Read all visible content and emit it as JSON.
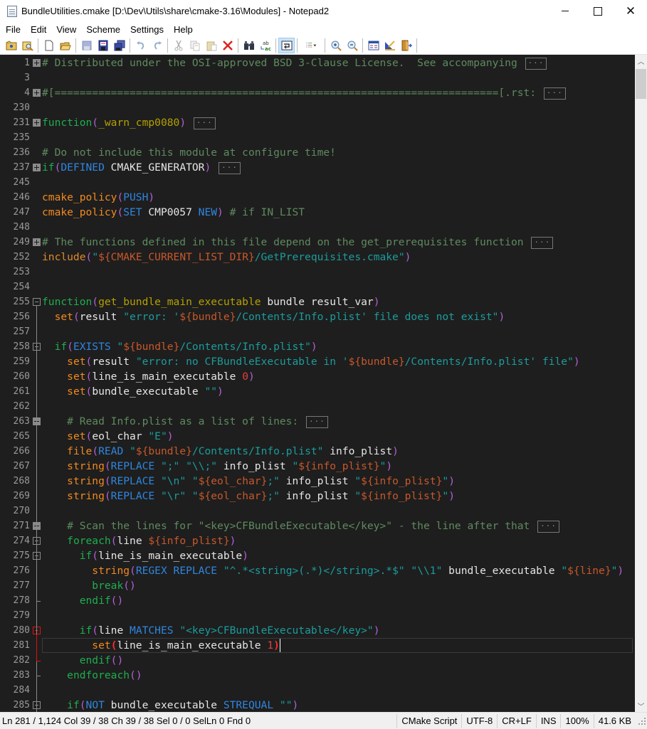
{
  "window": {
    "title": "BundleUtilities.cmake [D:\\Dev\\Utils\\share\\cmake-3.16\\Modules] - Notepad2",
    "minimize_glyph": "",
    "maximize_glyph": "",
    "close_glyph": "✕"
  },
  "menu": [
    "File",
    "Edit",
    "View",
    "Scheme",
    "Settings",
    "Help"
  ],
  "toolbar": {
    "buttons": [
      {
        "name": "browse-icon"
      },
      {
        "name": "find-file-icon"
      },
      {
        "name": "new-file-icon"
      },
      {
        "name": "open-file-icon"
      },
      {
        "name": "save-icon"
      },
      {
        "name": "save-as-icon"
      },
      {
        "name": "save-copy-icon"
      },
      {
        "name": "undo-icon"
      },
      {
        "name": "redo-icon"
      },
      {
        "name": "cut-icon"
      },
      {
        "name": "copy-icon"
      },
      {
        "name": "paste-icon"
      },
      {
        "name": "delete-icon"
      },
      {
        "name": "find-icon"
      },
      {
        "name": "replace-icon"
      },
      {
        "name": "word-wrap-icon",
        "active": true
      },
      {
        "name": "view-options-icon"
      },
      {
        "name": "zoom-in-icon"
      },
      {
        "name": "zoom-out-icon"
      },
      {
        "name": "scheme-icon"
      },
      {
        "name": "customize-scheme-icon"
      },
      {
        "name": "exit-icon"
      }
    ]
  },
  "editor": {
    "language": "CMake",
    "current_line": 281,
    "lines": [
      {
        "n": "1",
        "fold": "plus",
        "ellipsis": true,
        "tokens": [
          [
            "c-comment",
            "# Distributed under the OSI-approved BSD 3-Clause License.  See accompanying"
          ]
        ]
      },
      {
        "n": "3",
        "tokens": []
      },
      {
        "n": "4",
        "fold": "plus",
        "ellipsis": true,
        "tokens": [
          [
            "c-comment",
            "#[=======================================================================[.rst:"
          ]
        ]
      },
      {
        "n": "230",
        "tokens": []
      },
      {
        "n": "231",
        "fold": "plus",
        "ellipsis": true,
        "tokens": [
          [
            "c-kw",
            "function"
          ],
          [
            "c-paren",
            "("
          ],
          [
            "c-fn",
            "_warn_cmp0080"
          ],
          [
            "c-paren",
            ")"
          ]
        ]
      },
      {
        "n": "235",
        "tokens": []
      },
      {
        "n": "236",
        "tokens": [
          [
            "c-comment",
            "# Do not include this module at configure time!"
          ]
        ]
      },
      {
        "n": "237",
        "fold": "plus",
        "ellipsis": true,
        "tokens": [
          [
            "c-kw",
            "if"
          ],
          [
            "c-paren",
            "("
          ],
          [
            "c-arg",
            "DEFINED"
          ],
          [
            "c-plain",
            " CMAKE_GENERATOR"
          ],
          [
            "c-paren",
            ")"
          ]
        ]
      },
      {
        "n": "245",
        "tokens": []
      },
      {
        "n": "246",
        "tokens": [
          [
            "c-cmd",
            "cmake_policy"
          ],
          [
            "c-paren",
            "("
          ],
          [
            "c-arg",
            "PUSH"
          ],
          [
            "c-paren",
            ")"
          ]
        ]
      },
      {
        "n": "247",
        "tokens": [
          [
            "c-cmd",
            "cmake_policy"
          ],
          [
            "c-paren",
            "("
          ],
          [
            "c-arg",
            "SET"
          ],
          [
            "c-plain",
            " CMP0057 "
          ],
          [
            "c-arg",
            "NEW"
          ],
          [
            "c-paren",
            ")"
          ],
          [
            "c-comment",
            " # if IN_LIST"
          ]
        ]
      },
      {
        "n": "248",
        "tokens": []
      },
      {
        "n": "249",
        "fold": "plus",
        "ellipsis": true,
        "tokens": [
          [
            "c-comment",
            "# The functions defined in this file depend on the get_prerequisites function"
          ]
        ]
      },
      {
        "n": "252",
        "tokens": [
          [
            "c-inc",
            "include"
          ],
          [
            "c-paren",
            "("
          ],
          [
            "c-str",
            "\""
          ],
          [
            "c-var",
            "${CMAKE_CURRENT_LIST_DIR}"
          ],
          [
            "c-str",
            "/GetPrerequisites.cmake\""
          ],
          [
            "c-paren",
            ")"
          ]
        ]
      },
      {
        "n": "253",
        "tokens": []
      },
      {
        "n": "254",
        "tokens": []
      },
      {
        "n": "255",
        "fold": "minus",
        "tokens": [
          [
            "c-kw",
            "function"
          ],
          [
            "c-paren",
            "("
          ],
          [
            "c-fn",
            "get_bundle_main_executable"
          ],
          [
            "c-plain",
            " bundle result_var"
          ],
          [
            "c-paren",
            ")"
          ]
        ]
      },
      {
        "n": "256",
        "tokens": [
          [
            "c-plain",
            "  "
          ],
          [
            "c-cmd",
            "set"
          ],
          [
            "c-paren",
            "("
          ],
          [
            "c-plain",
            "result "
          ],
          [
            "c-str",
            "\"error: '"
          ],
          [
            "c-var",
            "${bundle}"
          ],
          [
            "c-str",
            "/Contents/Info.plist' file does not exist\""
          ],
          [
            "c-paren",
            ")"
          ]
        ]
      },
      {
        "n": "257",
        "tokens": []
      },
      {
        "n": "258",
        "fold": "minus",
        "tokens": [
          [
            "c-plain",
            "  "
          ],
          [
            "c-kw",
            "if"
          ],
          [
            "c-paren",
            "("
          ],
          [
            "c-arg",
            "EXISTS"
          ],
          [
            "c-plain",
            " "
          ],
          [
            "c-str",
            "\""
          ],
          [
            "c-var",
            "${bundle}"
          ],
          [
            "c-str",
            "/Contents/Info.plist\""
          ],
          [
            "c-paren",
            ")"
          ]
        ]
      },
      {
        "n": "259",
        "tokens": [
          [
            "c-plain",
            "    "
          ],
          [
            "c-cmd",
            "set"
          ],
          [
            "c-paren",
            "("
          ],
          [
            "c-plain",
            "result "
          ],
          [
            "c-str",
            "\"error: no CFBundleExecutable in '"
          ],
          [
            "c-var",
            "${bundle}"
          ],
          [
            "c-str",
            "/Contents/Info.plist' file\""
          ],
          [
            "c-paren",
            ")"
          ]
        ]
      },
      {
        "n": "260",
        "tokens": [
          [
            "c-plain",
            "    "
          ],
          [
            "c-cmd",
            "set"
          ],
          [
            "c-paren",
            "("
          ],
          [
            "c-plain",
            "line_is_main_executable "
          ],
          [
            "c-num",
            "0"
          ],
          [
            "c-paren",
            ")"
          ]
        ]
      },
      {
        "n": "261",
        "tokens": [
          [
            "c-plain",
            "    "
          ],
          [
            "c-cmd",
            "set"
          ],
          [
            "c-paren",
            "("
          ],
          [
            "c-plain",
            "bundle_executable "
          ],
          [
            "c-str",
            "\"\""
          ],
          [
            "c-paren",
            ")"
          ]
        ]
      },
      {
        "n": "262",
        "tokens": []
      },
      {
        "n": "263",
        "fold": "plus",
        "ellipsis": true,
        "tokens": [
          [
            "c-plain",
            "    "
          ],
          [
            "c-comment",
            "# Read Info.plist as a list of lines:"
          ]
        ]
      },
      {
        "n": "265",
        "tokens": [
          [
            "c-plain",
            "    "
          ],
          [
            "c-cmd",
            "set"
          ],
          [
            "c-paren",
            "("
          ],
          [
            "c-plain",
            "eol_char "
          ],
          [
            "c-str",
            "\"E\""
          ],
          [
            "c-paren",
            ")"
          ]
        ]
      },
      {
        "n": "266",
        "tokens": [
          [
            "c-plain",
            "    "
          ],
          [
            "c-cmd",
            "file"
          ],
          [
            "c-paren",
            "("
          ],
          [
            "c-arg",
            "READ"
          ],
          [
            "c-plain",
            " "
          ],
          [
            "c-str",
            "\""
          ],
          [
            "c-var",
            "${bundle}"
          ],
          [
            "c-str",
            "/Contents/Info.plist\""
          ],
          [
            "c-plain",
            " info_plist"
          ],
          [
            "c-paren",
            ")"
          ]
        ]
      },
      {
        "n": "267",
        "tokens": [
          [
            "c-plain",
            "    "
          ],
          [
            "c-cmd",
            "string"
          ],
          [
            "c-paren",
            "("
          ],
          [
            "c-arg",
            "REPLACE"
          ],
          [
            "c-plain",
            " "
          ],
          [
            "c-str",
            "\";\" \"\\\\;\""
          ],
          [
            "c-plain",
            " info_plist "
          ],
          [
            "c-str",
            "\""
          ],
          [
            "c-var",
            "${info_plist}"
          ],
          [
            "c-str",
            "\""
          ],
          [
            "c-paren",
            ")"
          ]
        ]
      },
      {
        "n": "268",
        "tokens": [
          [
            "c-plain",
            "    "
          ],
          [
            "c-cmd",
            "string"
          ],
          [
            "c-paren",
            "("
          ],
          [
            "c-arg",
            "REPLACE"
          ],
          [
            "c-plain",
            " "
          ],
          [
            "c-str",
            "\"\\n\" \""
          ],
          [
            "c-var",
            "${eol_char}"
          ],
          [
            "c-str",
            ";\""
          ],
          [
            "c-plain",
            " info_plist "
          ],
          [
            "c-str",
            "\""
          ],
          [
            "c-var",
            "${info_plist}"
          ],
          [
            "c-str",
            "\""
          ],
          [
            "c-paren",
            ")"
          ]
        ]
      },
      {
        "n": "269",
        "tokens": [
          [
            "c-plain",
            "    "
          ],
          [
            "c-cmd",
            "string"
          ],
          [
            "c-paren",
            "("
          ],
          [
            "c-arg",
            "REPLACE"
          ],
          [
            "c-plain",
            " "
          ],
          [
            "c-str",
            "\"\\r\" \""
          ],
          [
            "c-var",
            "${eol_char}"
          ],
          [
            "c-str",
            ";\""
          ],
          [
            "c-plain",
            " info_plist "
          ],
          [
            "c-str",
            "\""
          ],
          [
            "c-var",
            "${info_plist}"
          ],
          [
            "c-str",
            "\""
          ],
          [
            "c-paren",
            ")"
          ]
        ]
      },
      {
        "n": "270",
        "tokens": []
      },
      {
        "n": "271",
        "fold": "plus",
        "ellipsis": true,
        "tokens": [
          [
            "c-plain",
            "    "
          ],
          [
            "c-comment",
            "# Scan the lines for \"<key>CFBundleExecutable</key>\" - the line after that"
          ]
        ]
      },
      {
        "n": "274",
        "fold": "minus",
        "tokens": [
          [
            "c-plain",
            "    "
          ],
          [
            "c-kw",
            "foreach"
          ],
          [
            "c-paren",
            "("
          ],
          [
            "c-plain",
            "line "
          ],
          [
            "c-var",
            "${info_plist}"
          ],
          [
            "c-paren",
            ")"
          ]
        ]
      },
      {
        "n": "275",
        "fold": "minus",
        "tokens": [
          [
            "c-plain",
            "      "
          ],
          [
            "c-kw",
            "if"
          ],
          [
            "c-paren",
            "("
          ],
          [
            "c-plain",
            "line_is_main_executable"
          ],
          [
            "c-paren",
            ")"
          ]
        ]
      },
      {
        "n": "276",
        "tokens": [
          [
            "c-plain",
            "        "
          ],
          [
            "c-cmd",
            "string"
          ],
          [
            "c-paren",
            "("
          ],
          [
            "c-arg",
            "REGEX REPLACE"
          ],
          [
            "c-plain",
            " "
          ],
          [
            "c-str",
            "\"^.*<string>(.*)</string>.*$\" \"\\\\1\""
          ],
          [
            "c-plain",
            " bundle_executable "
          ],
          [
            "c-str",
            "\""
          ],
          [
            "c-var",
            "${line}"
          ],
          [
            "c-str",
            "\""
          ],
          [
            "c-paren",
            ")"
          ]
        ]
      },
      {
        "n": "277",
        "tokens": [
          [
            "c-plain",
            "        "
          ],
          [
            "c-kw",
            "break"
          ],
          [
            "c-paren",
            "()"
          ]
        ]
      },
      {
        "n": "278",
        "fold": "end",
        "tokens": [
          [
            "c-plain",
            "      "
          ],
          [
            "c-kw",
            "endif"
          ],
          [
            "c-paren",
            "()"
          ]
        ]
      },
      {
        "n": "279",
        "tokens": []
      },
      {
        "n": "280",
        "fold": "minus-red",
        "tokens": [
          [
            "c-plain",
            "      "
          ],
          [
            "c-kw",
            "if"
          ],
          [
            "c-paren",
            "("
          ],
          [
            "c-plain",
            "line "
          ],
          [
            "c-arg",
            "MATCHES"
          ],
          [
            "c-plain",
            " "
          ],
          [
            "c-str",
            "\"<key>CFBundleExecutable</key>\""
          ],
          [
            "c-paren",
            ")"
          ]
        ]
      },
      {
        "n": "281",
        "current": true,
        "tokens": [
          [
            "c-plain",
            "        "
          ],
          [
            "c-cmd",
            "set"
          ],
          [
            "c-paren-hl",
            "("
          ],
          [
            "c-plain",
            "line_is_main_executable "
          ],
          [
            "c-num",
            "1"
          ],
          [
            "c-paren-hl",
            ")"
          ]
        ]
      },
      {
        "n": "282",
        "fold": "end-red",
        "tokens": [
          [
            "c-plain",
            "      "
          ],
          [
            "c-kw",
            "endif"
          ],
          [
            "c-paren",
            "()"
          ]
        ]
      },
      {
        "n": "283",
        "fold": "end",
        "tokens": [
          [
            "c-plain",
            "    "
          ],
          [
            "c-kw",
            "endforeach"
          ],
          [
            "c-paren",
            "()"
          ]
        ]
      },
      {
        "n": "284",
        "tokens": []
      },
      {
        "n": "285",
        "fold": "minus",
        "tokens": [
          [
            "c-plain",
            "    "
          ],
          [
            "c-kw",
            "if"
          ],
          [
            "c-paren",
            "("
          ],
          [
            "c-arg",
            "NOT"
          ],
          [
            "c-plain",
            " bundle_executable "
          ],
          [
            "c-arg",
            "STREQUAL"
          ],
          [
            "c-plain",
            " "
          ],
          [
            "c-str",
            "\"\""
          ],
          [
            "c-paren",
            ")"
          ]
        ]
      }
    ],
    "ellipsis_label": "···"
  },
  "scrollbar": {
    "up_glyph": "︿",
    "down_glyph": "﹀",
    "position_fraction": 0.2
  },
  "status": {
    "position": "Ln 281 / 1,124   Col 39 / 38   Ch 39 / 38   Sel 0 / 0   SelLn 0   Fnd 0",
    "scheme": "CMake Script",
    "encoding": "UTF-8",
    "line_endings": "CR+LF",
    "insert_mode": "INS",
    "zoom": "100%",
    "file_size": "41.6 KB"
  }
}
